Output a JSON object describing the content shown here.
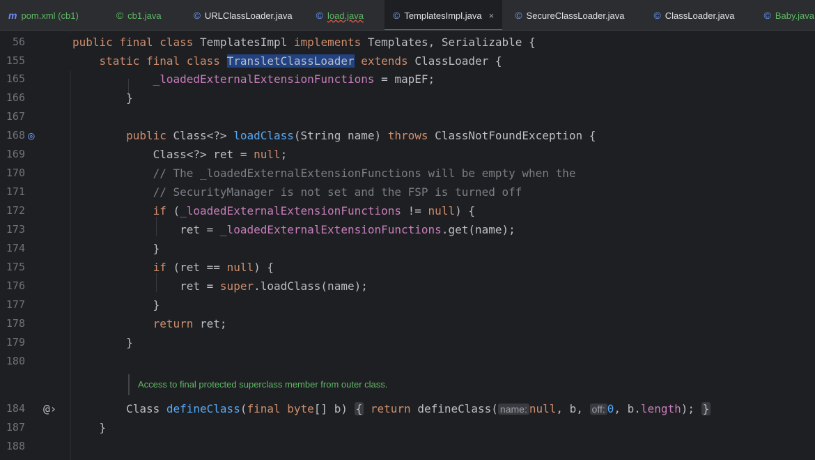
{
  "tabs": [
    {
      "name": "tab-pom-xml",
      "label": "pom.xml (cb1)",
      "icon": "maven-icon",
      "active": false
    },
    {
      "name": "tab-cb1-java",
      "label": "cb1.java",
      "icon": "class-icon",
      "active": false
    },
    {
      "name": "tab-urlclassloader-java",
      "label": "URLClassLoader.java",
      "icon": "class-icon",
      "active": false
    },
    {
      "name": "tab-load-java",
      "label": "load.java",
      "icon": "class-icon",
      "active": false
    },
    {
      "name": "tab-templatesimpl-java",
      "label": "TemplatesImpl.java",
      "icon": "class-icon",
      "active": true
    },
    {
      "name": "tab-secureclassloader-java",
      "label": "SecureClassLoader.java",
      "icon": "class-icon",
      "active": false
    },
    {
      "name": "tab-classloader-java",
      "label": "ClassLoader.java",
      "icon": "class-icon",
      "active": false
    },
    {
      "name": "tab-baby-java",
      "label": "Baby.java",
      "icon": "class-icon",
      "active": false
    }
  ],
  "close_glyph": "×",
  "line_numbers": [
    "56",
    "155",
    "165",
    "166",
    "167",
    "168",
    "169",
    "170",
    "171",
    "172",
    "173",
    "174",
    "175",
    "176",
    "177",
    "178",
    "179",
    "180",
    "184",
    "187",
    "188"
  ],
  "code": {
    "l56": {
      "kw1": "public final class",
      "name": "TemplatesImpl",
      "kw2": "implements",
      "rest": "Templates, Serializable {"
    },
    "l155": {
      "kw1": "static final class",
      "name": "TransletClassLoader",
      "kw2": "extends",
      "rest": "ClassLoader {"
    },
    "l165": {
      "field": "_loadedExternalExtensionFunctions",
      "rest": " = mapEF;"
    },
    "l166": "}",
    "l168": {
      "kw": "public",
      "t1": " Class<?> ",
      "fn": "loadClass",
      "t2": "(String name) ",
      "kw2": "throws",
      "t3": " ClassNotFoundException {"
    },
    "l169": {
      "t1": "Class<?> ret = ",
      "kw": "null",
      "t2": ";"
    },
    "l170": "// The _loadedExternalExtensionFunctions will be empty when the",
    "l171": "// SecurityManager is not set and the FSP is turned off",
    "l172": {
      "kw": "if",
      "t1": " (",
      "field": "_loadedExternalExtensionFunctions",
      "t2": " != ",
      "kw2": "null",
      "t3": ") {"
    },
    "l173": {
      "t1": "ret = ",
      "field": "_loadedExternalExtensionFunctions",
      "t2": ".get(name);"
    },
    "l174": "}",
    "l175": {
      "kw": "if",
      "t1": " (ret == ",
      "kw2": "null",
      "t2": ") {"
    },
    "l176": {
      "t1": "ret = ",
      "kw": "super",
      "t2": ".loadClass(name);"
    },
    "l177": "}",
    "l178": {
      "kw": "return",
      "t1": " ret;"
    },
    "l179": "}",
    "doc_comment": "Access to final protected superclass member from outer class.",
    "l184": {
      "t1": "Class ",
      "fn": "defineClass",
      "t2": "(",
      "kw": "final byte",
      "t3": "[] b)",
      "fold_open": "{",
      "kw2": "return",
      "t4": " defineClass(",
      "hint1": "name:",
      "kw3": "null",
      "t5": ", b, ",
      "hint2": "off:",
      "num": "0",
      "t6": ", b.",
      "field": "length",
      "t7": ");",
      "fold_close": "}"
    },
    "l187": "}"
  },
  "gutter_icons": {
    "line168": "override-icon",
    "line184": "annotation-icon"
  }
}
